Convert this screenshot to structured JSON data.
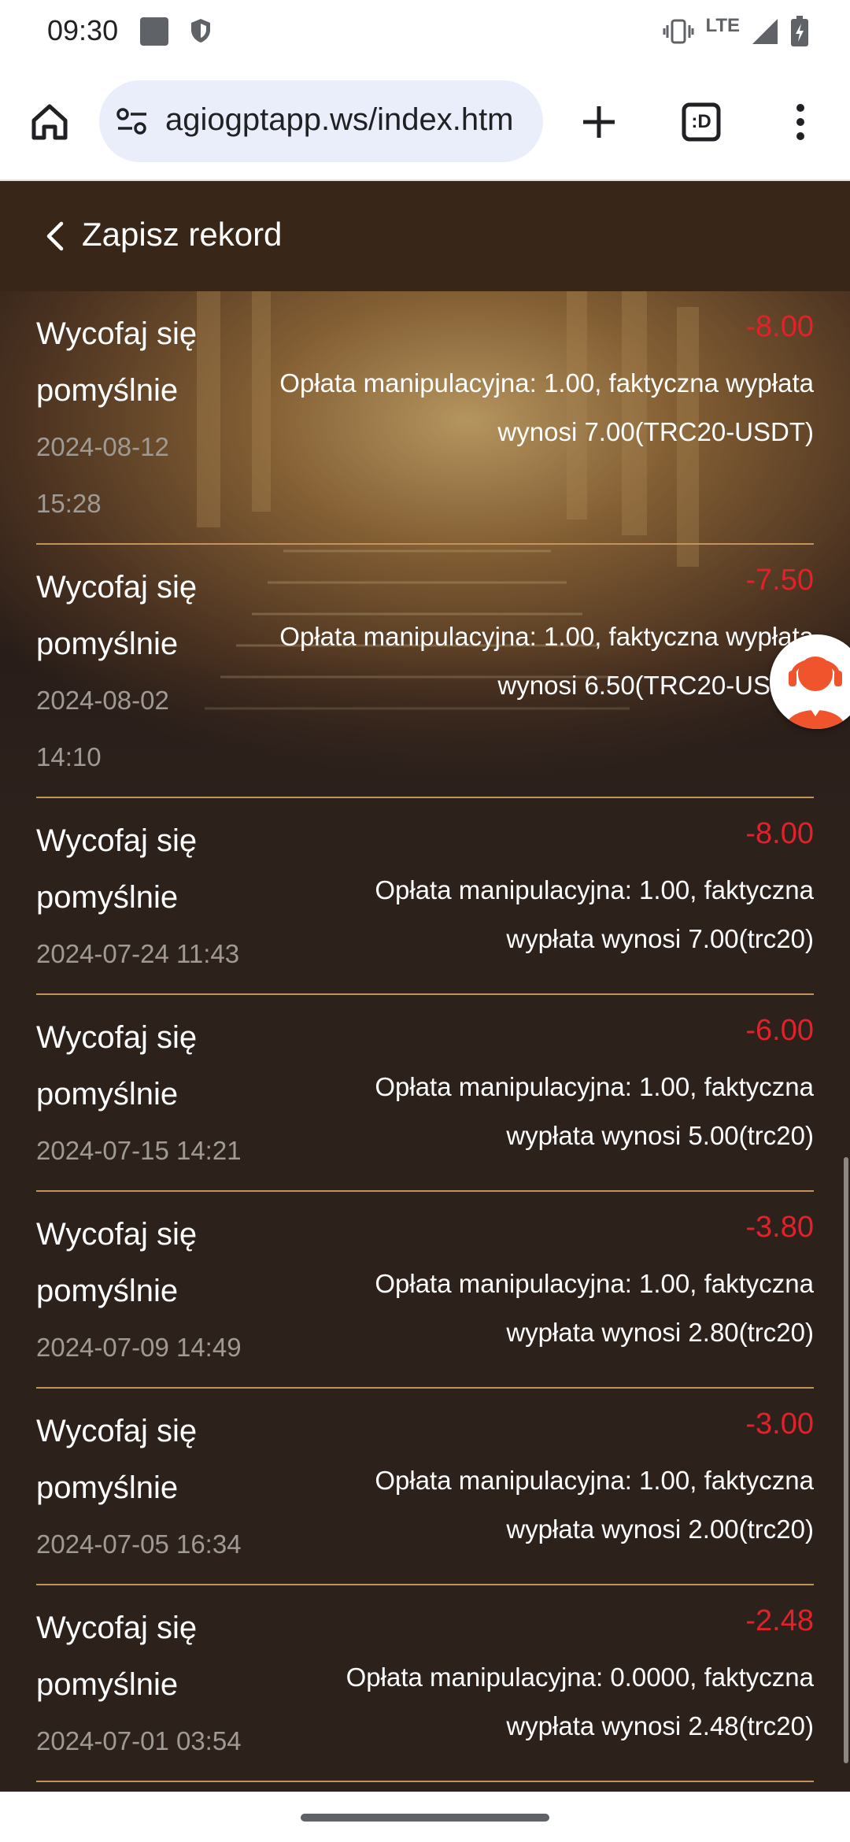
{
  "status_bar": {
    "time": "09:30",
    "network": "LTE",
    "icons": [
      "notification-square-icon",
      "shield-icon",
      "vibrate-icon",
      "signal-icon",
      "battery-charging-icon"
    ]
  },
  "browser": {
    "url": "agiogptapp.ws/index.htm",
    "tab_count": ":D",
    "icons": [
      "home-icon",
      "site-settings-icon",
      "new-tab-plus-icon",
      "tab-switcher-icon",
      "more-vert-icon"
    ]
  },
  "header": {
    "title": "Zapisz rekord"
  },
  "records": [
    {
      "title": "Wycofaj się pomyślnie",
      "date": "2024-08-12 15:28",
      "amount": "-8.00",
      "description": "Opłata manipulacyjna: 1.00, faktyczna wypłata wynosi 7.00(TRC20-USDT)"
    },
    {
      "title": "Wycofaj się pomyślnie",
      "date": "2024-08-02 14:10",
      "amount": "-7.50",
      "description": "Opłata manipulacyjna: 1.00, faktyczna wypłata wynosi 6.50(TRC20-USDT)"
    },
    {
      "title": "Wycofaj się pomyślnie",
      "date": "2024-07-24 11:43",
      "amount": "-8.00",
      "description": "Opłata manipulacyjna: 1.00, faktyczna wypłata wynosi 7.00(trc20)"
    },
    {
      "title": "Wycofaj się pomyślnie",
      "date": "2024-07-15 14:21",
      "amount": "-6.00",
      "description": "Opłata manipulacyjna: 1.00, faktyczna wypłata wynosi 5.00(trc20)"
    },
    {
      "title": "Wycofaj się pomyślnie",
      "date": "2024-07-09 14:49",
      "amount": "-3.80",
      "description": "Opłata manipulacyjna: 1.00, faktyczna wypłata wynosi 2.80(trc20)"
    },
    {
      "title": "Wycofaj się pomyślnie",
      "date": "2024-07-05 16:34",
      "amount": "-3.00",
      "description": "Opłata manipulacyjna: 1.00, faktyczna wypłata wynosi 2.00(trc20)"
    },
    {
      "title": "Wycofaj się pomyślnie",
      "date": "2024-07-01 03:54",
      "amount": "-2.48",
      "description": "Opłata manipulacyjna: 0.0000, faktyczna wypłata wynosi 2.48(trc20)"
    }
  ],
  "colors": {
    "header_bg": "#382719",
    "content_bg": "#2d211c",
    "divider": "#c5935a",
    "amount": "#e1222a",
    "date": "#a09a95"
  },
  "support": {
    "icon": "customer-service-icon"
  }
}
